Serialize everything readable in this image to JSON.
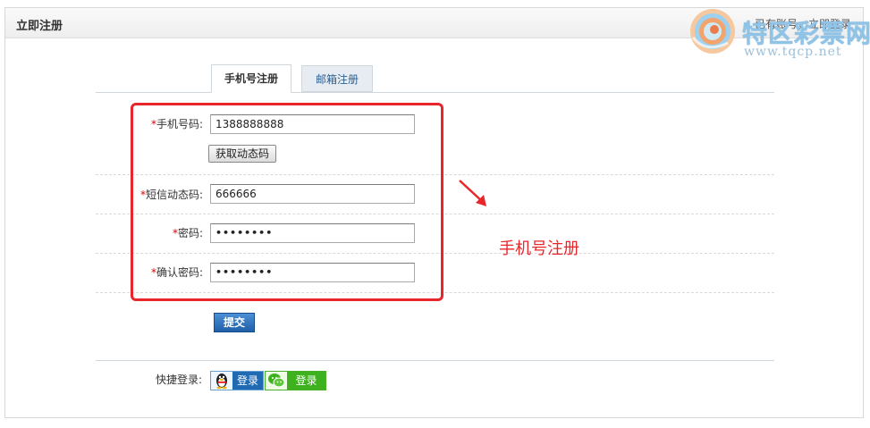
{
  "header": {
    "title": "立即注册",
    "right_link": "已有账号，立即登录"
  },
  "watermark": {
    "title": "特区彩票网",
    "url": "www.tqcp.net"
  },
  "tabs": [
    {
      "label": "手机号注册",
      "active": true
    },
    {
      "label": "邮箱注册",
      "active": false
    }
  ],
  "form": {
    "required_mark": "*",
    "phone": {
      "label": "手机号码:",
      "value": "1388888888"
    },
    "get_code_button": "获取动态码",
    "sms_code": {
      "label": "短信动态码:",
      "value": "666666"
    },
    "password": {
      "label": "密码:",
      "value": "••••••••"
    },
    "confirm_password": {
      "label": "确认密码:",
      "value": "••••••••"
    },
    "submit_button": "提交"
  },
  "annotation": {
    "text": "手机号注册",
    "color": "#e8262b"
  },
  "quick_login": {
    "label": "快捷登录:",
    "qq_button": "登录",
    "wechat_button": "登录",
    "icons": [
      "qq-penguin-icon",
      "wechat-icon"
    ]
  },
  "colors": {
    "accent_blue": "#1f6ab3",
    "wechat_green": "#3db21e",
    "highlight_red": "#e8262b"
  }
}
